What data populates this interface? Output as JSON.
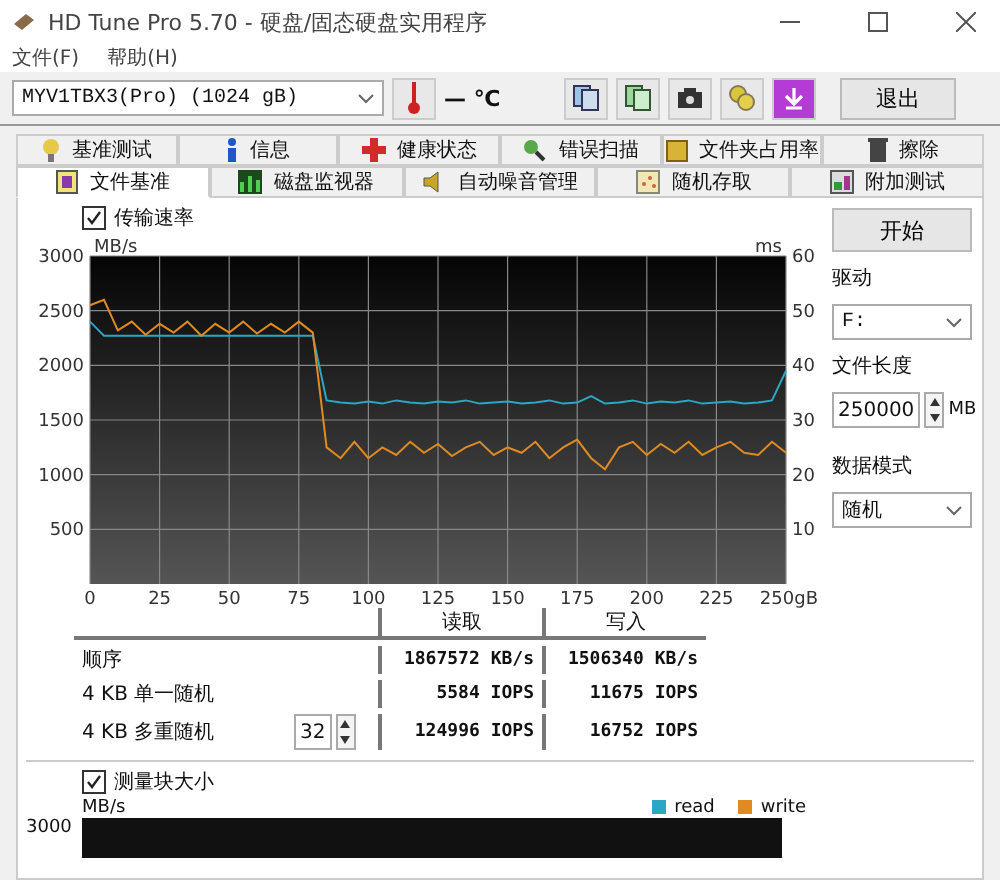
{
  "window": {
    "title": "HD Tune Pro 5.70 - 硬盘/固态硬盘实用程序"
  },
  "menu": [
    "文件(F)",
    "帮助(H)"
  ],
  "toolbar": {
    "drive": "MYV1TBX3(Pro) (1024 gB)",
    "temperature": "— ℃",
    "exit": "退出"
  },
  "tabs_back": [
    {
      "label": "基准测试",
      "selected": false
    },
    {
      "label": "信息",
      "selected": false
    },
    {
      "label": "健康状态",
      "selected": false
    },
    {
      "label": "错误扫描",
      "selected": false
    },
    {
      "label": "文件夹占用率",
      "selected": false
    },
    {
      "label": "擦除",
      "selected": false
    }
  ],
  "tabs_front": [
    {
      "label": "文件基准",
      "selected": true
    },
    {
      "label": "磁盘监视器",
      "selected": false
    },
    {
      "label": "自动噪音管理",
      "selected": false
    },
    {
      "label": "随机存取",
      "selected": false
    },
    {
      "label": "附加测试",
      "selected": false
    }
  ],
  "transfer": {
    "label": "传输速率",
    "checked": true,
    "chart_data": {
      "type": "line",
      "grid": true,
      "ylabel": "MB/s",
      "ylim": [
        0,
        3000
      ],
      "xlim": [
        0,
        250
      ],
      "yticks": [
        500,
        1000,
        1500,
        2000,
        2500,
        3000
      ],
      "xticks": [
        0,
        25,
        50,
        75,
        100,
        125,
        150,
        175,
        200,
        225,
        {
          "value": 250,
          "label": "250gB"
        }
      ],
      "x": [
        0,
        5,
        10,
        15,
        20,
        25,
        30,
        35,
        40,
        45,
        50,
        55,
        60,
        65,
        70,
        75,
        80,
        85,
        90,
        95,
        100,
        105,
        110,
        115,
        120,
        125,
        130,
        135,
        140,
        145,
        150,
        155,
        160,
        165,
        170,
        175,
        180,
        185,
        190,
        195,
        200,
        205,
        210,
        215,
        220,
        225,
        230,
        235,
        240,
        245,
        250
      ],
      "series": [
        {
          "color": "#2aa7c4",
          "values": [
            2400,
            2270,
            2270,
            2270,
            2270,
            2270,
            2270,
            2270,
            2270,
            2270,
            2270,
            2270,
            2270,
            2270,
            2270,
            2270,
            2270,
            1680,
            1660,
            1650,
            1670,
            1650,
            1680,
            1660,
            1650,
            1670,
            1660,
            1680,
            1650,
            1660,
            1670,
            1650,
            1660,
            1680,
            1650,
            1660,
            1720,
            1650,
            1660,
            1680,
            1650,
            1670,
            1660,
            1680,
            1650,
            1660,
            1670,
            1650,
            1660,
            1680,
            1950
          ]
        },
        {
          "color": "#e08a22",
          "values": [
            2550,
            2600,
            2320,
            2400,
            2280,
            2380,
            2300,
            2400,
            2270,
            2380,
            2300,
            2400,
            2290,
            2380,
            2300,
            2400,
            2300,
            1250,
            1150,
            1300,
            1150,
            1250,
            1180,
            1300,
            1200,
            1280,
            1170,
            1250,
            1300,
            1180,
            1250,
            1200,
            1300,
            1150,
            1250,
            1320,
            1150,
            1050,
            1250,
            1300,
            1180,
            1280,
            1200,
            1300,
            1180,
            1250,
            1300,
            1200,
            1180,
            1300,
            1200
          ]
        }
      ]
    },
    "right_axis": {
      "label": "ms",
      "ticks": [
        "60",
        "50",
        "40",
        "30",
        "20",
        "10"
      ]
    }
  },
  "side": {
    "start": "开始",
    "drive_label": "驱动",
    "drive": "F:",
    "size_label": "文件长度",
    "size": "250000",
    "size_unit": "MB",
    "mode_label": "数据模式",
    "mode": "随机"
  },
  "results": {
    "columns": [
      "读取",
      "写入"
    ],
    "rows": [
      {
        "label": "顺序",
        "read": "1867572 KB/s",
        "write": "1506340 KB/s"
      },
      {
        "label": "4 KB 单一随机",
        "read": "5584 IOPS",
        "write": "11675 IOPS"
      },
      {
        "label": "4 KB 多重随机",
        "queue": "32",
        "read": "124996 IOPS",
        "write": "16752 IOPS"
      }
    ]
  },
  "block": {
    "label": "测量块大小",
    "checked": true,
    "ylabel": "MB/s",
    "ytop": "3000",
    "legend": [
      {
        "name": "read",
        "color": "#2aa7c4"
      },
      {
        "name": "write",
        "color": "#e08a22"
      }
    ]
  }
}
